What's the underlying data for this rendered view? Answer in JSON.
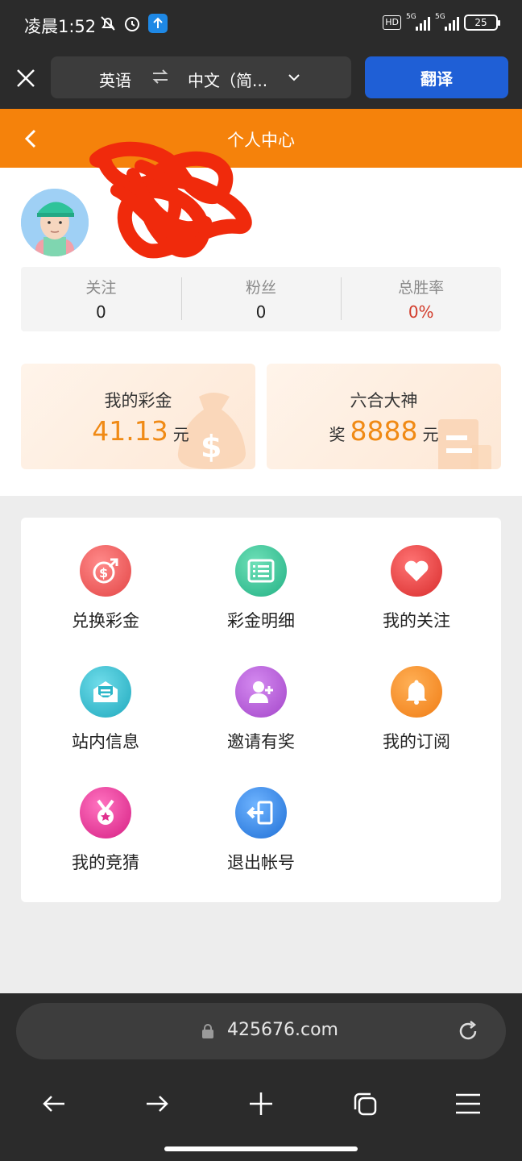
{
  "status_bar": {
    "time": "凌晨1:52",
    "network_1": "5G",
    "network_2": "5G",
    "hd_label": "HD",
    "battery": "25"
  },
  "translate_bar": {
    "source_lang": "英语",
    "target_lang": "中文（简...",
    "translate_button": "翻译"
  },
  "header": {
    "title": "个人中心"
  },
  "stats": [
    {
      "label": "关注",
      "value": "0"
    },
    {
      "label": "粉丝",
      "value": "0"
    },
    {
      "label": "总胜率",
      "value": "0%"
    }
  ],
  "cards": {
    "balance": {
      "title": "我的彩金",
      "value": "41.13",
      "unit": "元"
    },
    "master": {
      "title": "六合大神",
      "prefix": "奖",
      "value": "8888",
      "unit": "元"
    }
  },
  "menu": [
    {
      "label": "兑换彩金",
      "icon": "exchange-money-icon",
      "color": "#ea4f4f"
    },
    {
      "label": "彩金明细",
      "icon": "list-detail-icon",
      "color": "#2fbf8f"
    },
    {
      "label": "我的关注",
      "icon": "heart-icon",
      "color": "#e63a3a"
    },
    {
      "label": "站内信息",
      "icon": "mail-icon",
      "color": "#27b3c7"
    },
    {
      "label": "邀请有奖",
      "icon": "add-user-icon",
      "color": "#b14fd6"
    },
    {
      "label": "我的订阅",
      "icon": "bell-icon",
      "color": "#f58a1f"
    },
    {
      "label": "我的竞猜",
      "icon": "medal-icon",
      "color": "#e8389a"
    },
    {
      "label": "退出帐号",
      "icon": "logout-icon",
      "color": "#2f7fe0"
    }
  ],
  "browser": {
    "url": "425676.com"
  },
  "colors": {
    "accent_orange": "#f5820b",
    "translate_blue": "#1f5fd6",
    "money_orange": "#f08a15",
    "win_rate_red": "#d23b2a"
  }
}
